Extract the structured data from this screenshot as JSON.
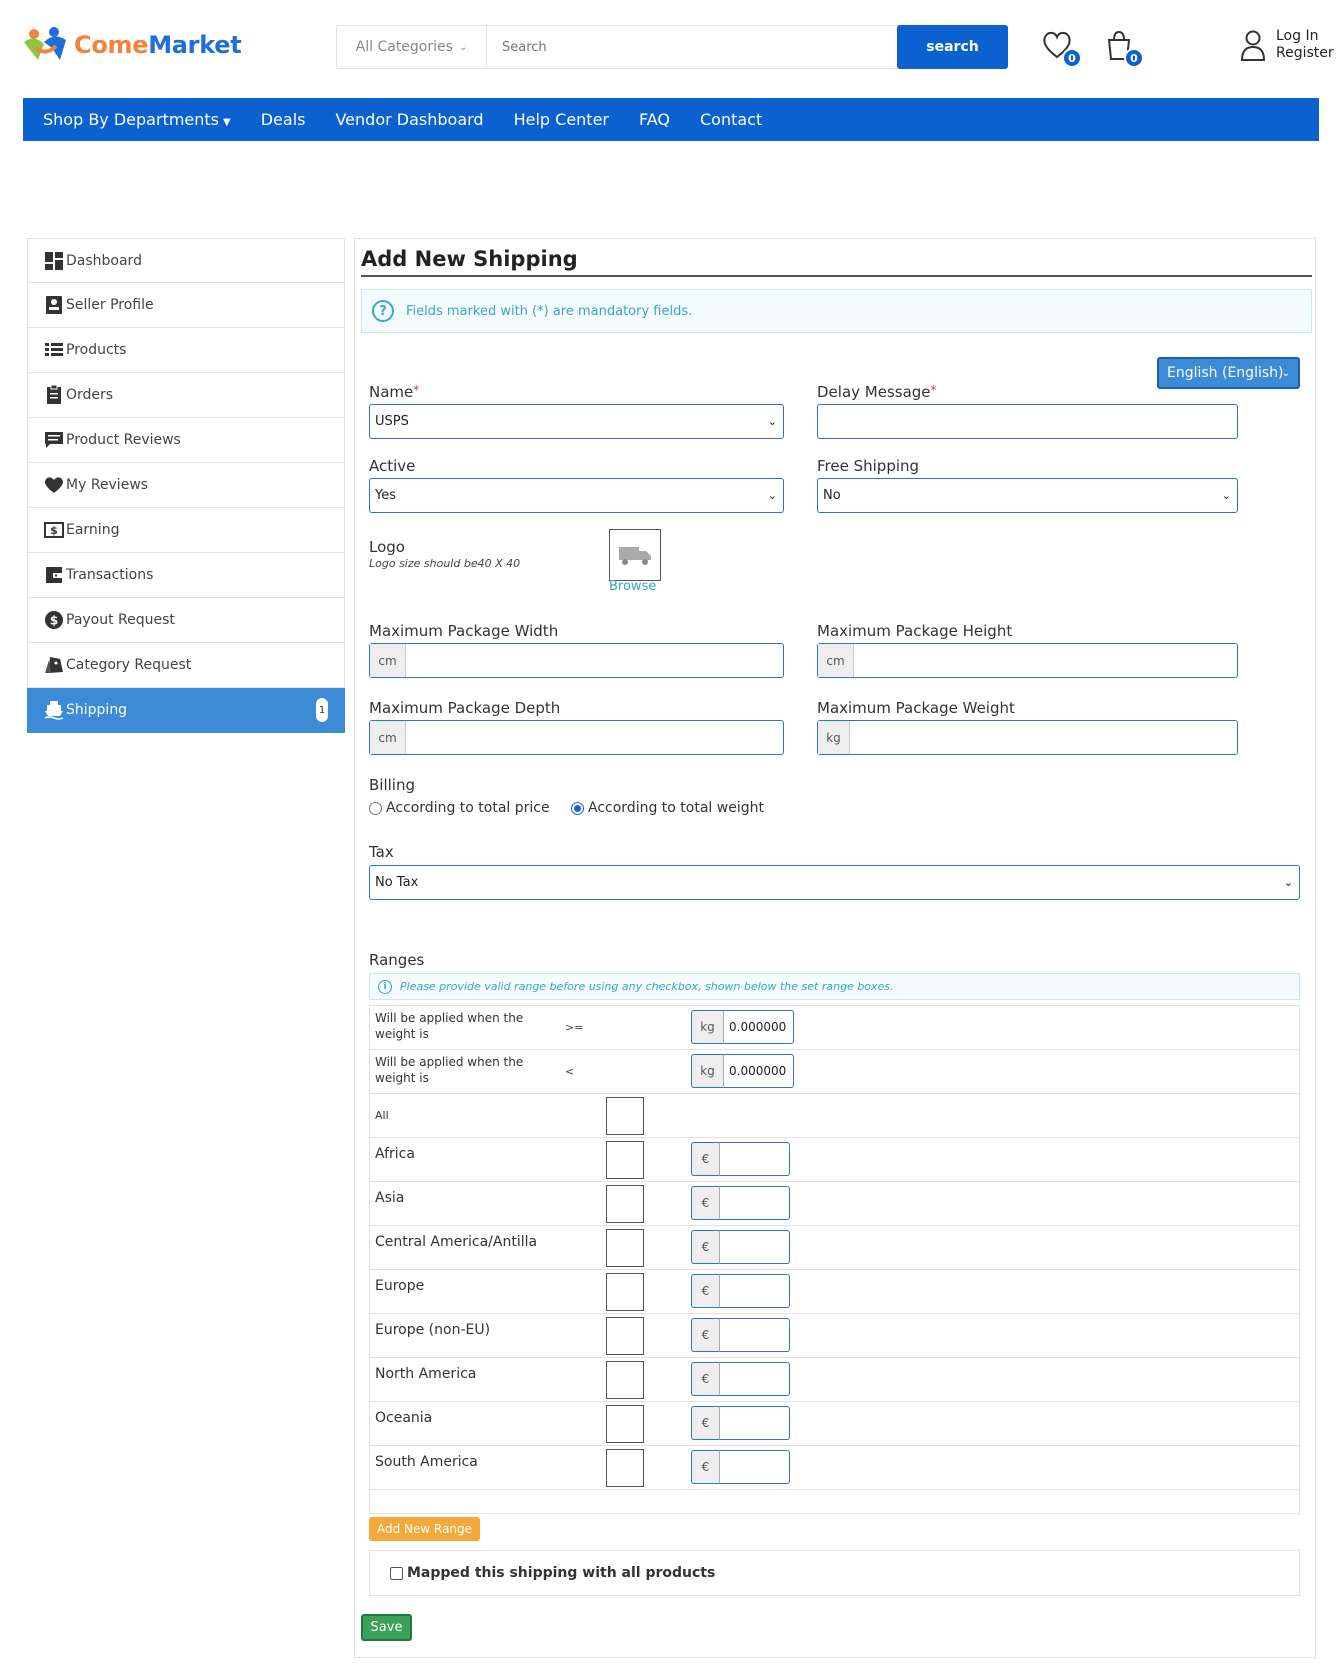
{
  "brand": {
    "name_part1": "Come",
    "name_part2": "Market"
  },
  "search": {
    "category_label": "All Categories",
    "placeholder": "Search",
    "button_label": "search"
  },
  "header": {
    "wishlist_count": "0",
    "cart_count": "0",
    "login_label": "Log In",
    "register_label": "Register"
  },
  "nav": {
    "items": [
      "Shop By Departments",
      "Deals",
      "Vendor Dashboard",
      "Help Center",
      "FAQ",
      "Contact"
    ]
  },
  "sidebar": {
    "items": [
      {
        "label": "Dashboard",
        "icon": "dashboard-icon"
      },
      {
        "label": "Seller Profile",
        "icon": "profile-icon"
      },
      {
        "label": "Products",
        "icon": "list-icon"
      },
      {
        "label": "Orders",
        "icon": "clipboard-icon"
      },
      {
        "label": "Product Reviews",
        "icon": "review-icon"
      },
      {
        "label": "My Reviews",
        "icon": "heart-icon"
      },
      {
        "label": "Earning",
        "icon": "dollar-icon"
      },
      {
        "label": "Transactions",
        "icon": "wallet-icon"
      },
      {
        "label": "Payout Request",
        "icon": "dollar-circle-icon"
      },
      {
        "label": "Category Request",
        "icon": "tags-icon"
      },
      {
        "label": "Shipping",
        "icon": "ship-icon",
        "count": "1"
      }
    ],
    "active_color": "#3b8bd6"
  },
  "form": {
    "title": "Add New Shipping",
    "mandatory_note": "Fields marked with (*) are mandatory fields.",
    "language": "English (English)",
    "name_label": "Name",
    "name_value": "USPS",
    "delay_label": "Delay Message",
    "delay_value": "",
    "active_label": "Active",
    "active_value": "Yes",
    "free_shipping_label": "Free Shipping",
    "free_shipping_value": "No",
    "logo_label": "Logo",
    "logo_hint": "Logo size should be40 X 40",
    "browse_label": "Browse",
    "max_width_label": "Maximum Package Width",
    "max_height_label": "Maximum Package Height",
    "max_depth_label": "Maximum Package Depth",
    "max_weight_label": "Maximum Package Weight",
    "unit_cm": "cm",
    "unit_kg": "kg",
    "billing_label": "Billing",
    "billing_option_price": "According to total price",
    "billing_option_weight": "According to total weight",
    "billing_selected": "According to total weight",
    "tax_label": "Tax",
    "tax_value": "No Tax",
    "ranges_label": "Ranges",
    "ranges_note": "Please provide valid range before using any checkbox, shown below the set range boxes.",
    "range_rows": [
      {
        "label": "Will be applied when the weight is",
        "operator": ">=",
        "unit": "kg",
        "value": "0.000000"
      },
      {
        "label": "Will be applied when the weight is",
        "operator": "<",
        "unit": "kg",
        "value": "0.000000"
      }
    ],
    "all_label": "All",
    "currency": "€",
    "zones": [
      "Africa",
      "Asia",
      "Central America/Antilla",
      "Europe",
      "Europe (non-EU)",
      "North America",
      "Oceania",
      "South America"
    ],
    "add_range_label": "Add New Range",
    "mapped_label": "Mapped this shipping with all products",
    "save_label": "Save"
  },
  "colors": {
    "primary": "#0b61cf",
    "info": "#3aa6c8",
    "warning": "#f4a93a",
    "success": "#3aa05a"
  }
}
